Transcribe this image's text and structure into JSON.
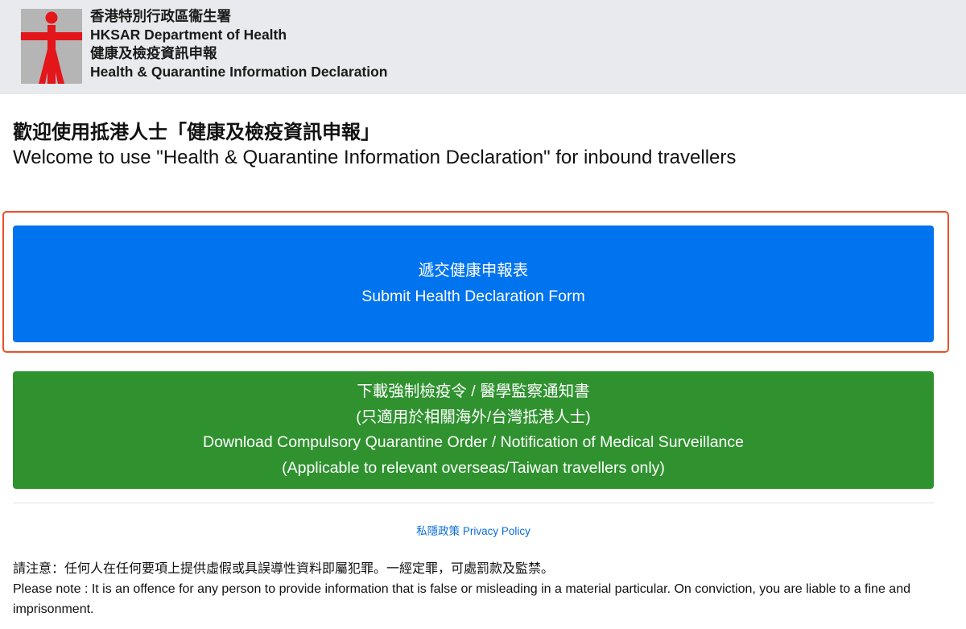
{
  "header": {
    "org_zh": "香港特別行政區衞生署",
    "org_en": "HKSAR Department of Health",
    "app_zh": "健康及檢疫資訊申報",
    "app_en": "Health & Quarantine Information Declaration",
    "logo_icon": "dh-logo-icon",
    "colors": {
      "logo_red": "#e3161b",
      "logo_grey": "#b5b5b5",
      "background": "#e9eaed"
    }
  },
  "welcome": {
    "zh": "歡迎使用抵港人士「健康及檢疫資訊申報」",
    "en": "Welcome to use \"Health & Quarantine Information Declaration\" for inbound travellers"
  },
  "submit_button": {
    "line1": "遞交健康申報表",
    "line2": "Submit Health Declaration Form",
    "color": "#0073ee"
  },
  "download_button": {
    "line1": "下載強制檢疫令 / 醫學監察通知書",
    "line2": "(只適用於相關海外/台灣抵港人士)",
    "line3": "Download Compulsory Quarantine Order / Notification of Medical Surveillance",
    "line4": "(Applicable to relevant overseas/Taiwan travellers only)",
    "color": "#2f922f"
  },
  "privacy_link": "私隱政策 Privacy Policy",
  "note": {
    "zh": "請注意：任何人在任何要項上提供虛假或具誤導性資料即屬犯罪。一經定罪，可處罰款及監禁。",
    "en": "Please note : It is an offence for any person to provide information that is false or misleading in a material particular. On conviction, you are liable to a fine and imprisonment."
  }
}
